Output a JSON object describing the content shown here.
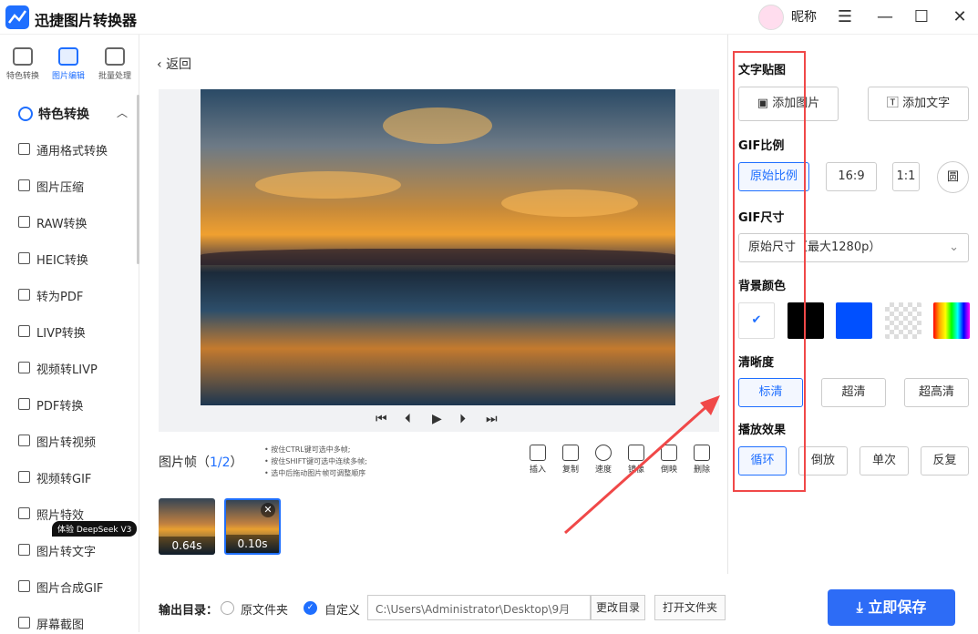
{
  "app": {
    "title": "迅捷图片转换器",
    "nickname": "昵称"
  },
  "window": {
    "menu": "☰",
    "minimize": "—",
    "maximize": "☐",
    "close": "✕"
  },
  "sidebar": {
    "top_tabs": [
      "特色转换",
      "图片编辑",
      "批量处理"
    ],
    "section_title": "特色转换",
    "items": [
      "通用格式转换",
      "图片压缩",
      "RAW转换",
      "HEIC转换",
      "转为PDF",
      "LIVP转换",
      "视频转LIVP",
      "PDF转换",
      "图片转视频",
      "视频转GIF",
      "照片特效",
      "图片转文字",
      "图片合成GIF",
      "屏幕截图"
    ],
    "badge": "体验 DeepSeek V3"
  },
  "main": {
    "back": "返回",
    "frames_title": "图片帧（",
    "frames_count": "1/2",
    "frames_close": "）",
    "tips": [
      "按住CTRL键可选中多帧;",
      "按住SHIFT键可选中连续多帧;",
      "选中后拖动图片帧可调整顺序"
    ],
    "tools": [
      "插入",
      "复制",
      "速度",
      "镜像",
      "倒映",
      "删除"
    ],
    "thumbs": [
      "0.64s",
      "0.10s"
    ]
  },
  "output": {
    "label": "输出目录：",
    "option_original": "原文件夹",
    "option_custom": "自定义",
    "path": "C:\\Users\\Administrator\\Desktop\\9月",
    "change_dir": "更改目录",
    "open_folder": "打开文件夹",
    "save": "立即保存"
  },
  "panel": {
    "sticker_title": "文字贴图",
    "add_image": "添加图片",
    "add_text": "添加文字",
    "ratio_title": "GIF比例",
    "ratios": [
      "原始比例",
      "16:9",
      "1:1",
      "圆"
    ],
    "size_title": "GIF尺寸",
    "size_value": "原始尺寸（最大1280p）",
    "bg_title": "背景颜色",
    "bg_colors": [
      "#ffffff",
      "#000000",
      "#0050ff"
    ],
    "clarity_title": "清晰度",
    "clarity": [
      "标清",
      "超清",
      "超高清"
    ],
    "play_title": "播放效果",
    "play": [
      "循环",
      "倒放",
      "单次",
      "反复"
    ]
  }
}
